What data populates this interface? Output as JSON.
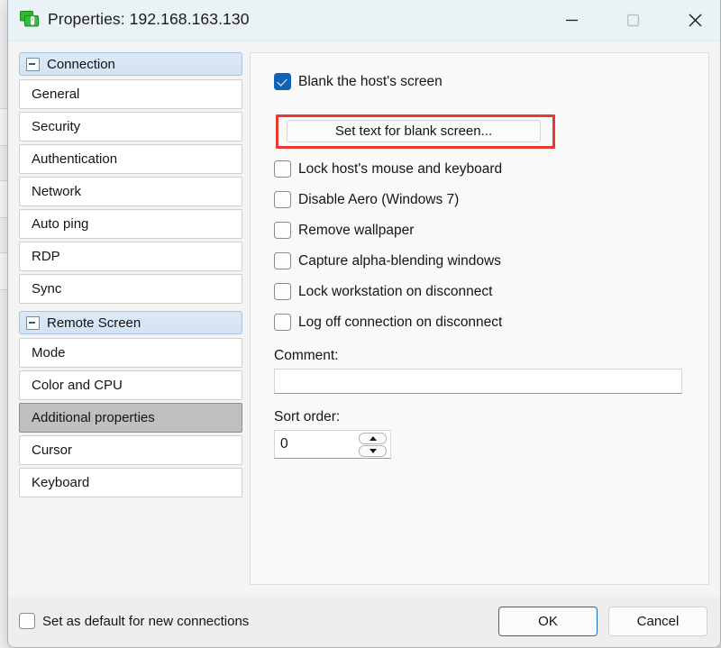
{
  "window": {
    "title": "Properties: 192.168.163.130",
    "app_icon": "remote-screen-icon",
    "controls": {
      "minimize": "minimize-icon",
      "maximize": "maximize-icon",
      "close": "close-icon"
    }
  },
  "sidebar": {
    "groups": [
      {
        "label": "Connection",
        "toggle": "collapse-icon",
        "items": [
          {
            "label": "General",
            "selected": false
          },
          {
            "label": "Security",
            "selected": false
          },
          {
            "label": "Authentication",
            "selected": false
          },
          {
            "label": "Network",
            "selected": false
          },
          {
            "label": "Auto ping",
            "selected": false
          },
          {
            "label": "RDP",
            "selected": false
          },
          {
            "label": "Sync",
            "selected": false
          }
        ]
      },
      {
        "label": "Remote Screen",
        "toggle": "collapse-icon",
        "items": [
          {
            "label": "Mode",
            "selected": false
          },
          {
            "label": "Color and CPU",
            "selected": false
          },
          {
            "label": "Additional properties",
            "selected": true
          },
          {
            "label": "Cursor",
            "selected": false
          },
          {
            "label": "Keyboard",
            "selected": false
          }
        ]
      }
    ]
  },
  "content": {
    "options": [
      {
        "label": "Blank the host's screen",
        "checked": true
      },
      {
        "label": "Lock host's mouse and keyboard",
        "checked": false
      },
      {
        "label": "Disable Aero (Windows 7)",
        "checked": false
      },
      {
        "label": "Remove wallpaper",
        "checked": false
      },
      {
        "label": "Capture alpha-blending windows",
        "checked": false
      },
      {
        "label": "Lock workstation on disconnect",
        "checked": false
      },
      {
        "label": "Log off connection on disconnect",
        "checked": false
      }
    ],
    "blank_screen_button": {
      "label": "Set text for blank screen...",
      "highlighted": true,
      "highlight_color": "#e8392f"
    },
    "comment": {
      "label": "Comment:",
      "value": "",
      "placeholder": ""
    },
    "sort_order": {
      "label": "Sort order:",
      "value": "0",
      "increment_icon": "chevron-up-icon",
      "decrement_icon": "chevron-down-icon"
    }
  },
  "footer": {
    "default_checkbox": {
      "label": "Set as default for new connections",
      "checked": false
    },
    "ok_label": "OK",
    "cancel_label": "Cancel",
    "accent_color": "#1a6dbd"
  }
}
